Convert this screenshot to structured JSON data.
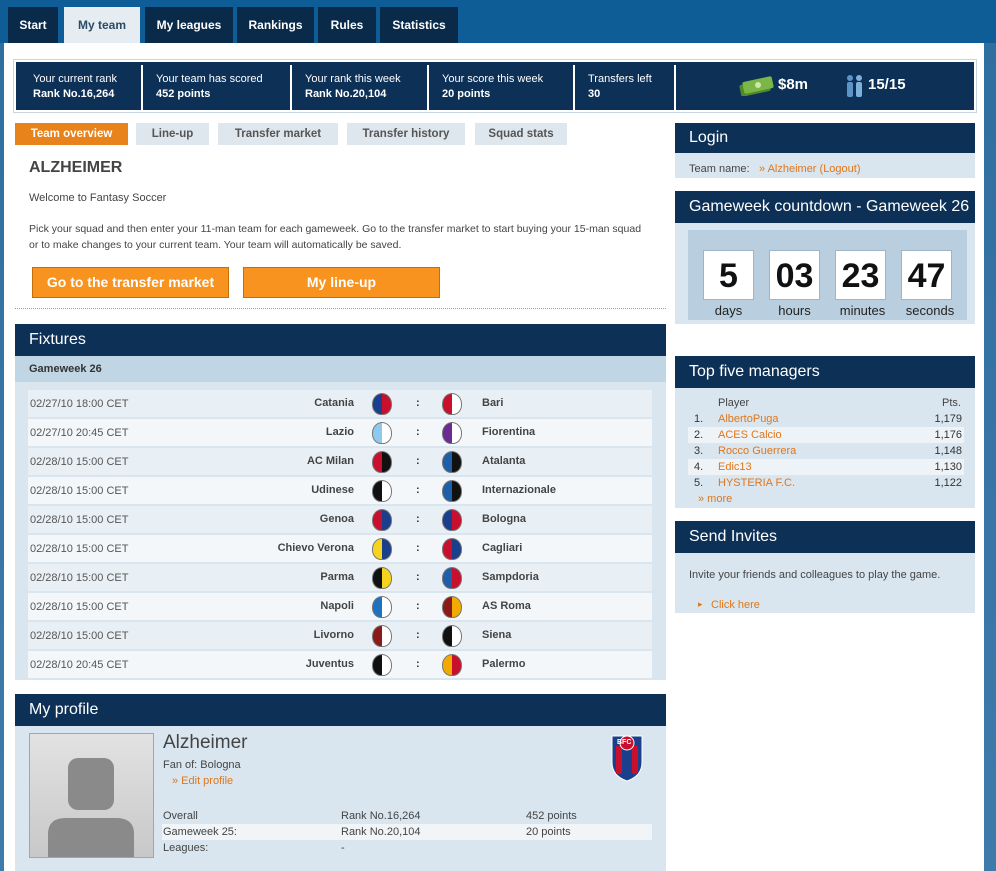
{
  "nav": {
    "tabs": [
      "Start",
      "My team",
      "My leagues",
      "Rankings",
      "Rules",
      "Statistics"
    ]
  },
  "stats": {
    "current_rank_label": "Your current rank",
    "current_rank_value": "Rank No.16,264",
    "team_scored_label": "Your team has scored",
    "team_scored_value": "452 points",
    "rank_week_label": "Your rank this week",
    "rank_week_value": "Rank No.20,104",
    "score_week_label": "Your score this week",
    "score_week_value": "20 points",
    "transfers_label": "Transfers left",
    "transfers_value": "30",
    "money": "$8m",
    "squad_count": "15/15"
  },
  "subtabs": [
    "Team overview",
    "Line-up",
    "Transfer market",
    "Transfer history",
    "Squad stats"
  ],
  "overview": {
    "team_name": "ALZHEIMER",
    "welcome": "Welcome to Fantasy Soccer",
    "intro": "Pick your squad and then enter your 11-man team for each gameweek. Go to the transfer market to start buying your 15-man squad or to make changes to your current team. Your team will automatically be saved.",
    "transfer_btn": "Go to the transfer market",
    "lineup_btn": "My line-up"
  },
  "fixtures": {
    "title": "Fixtures",
    "gameweek": "Gameweek 26",
    "rows": [
      {
        "date": "02/27/10 18:00 CET",
        "home": "Catania",
        "away": "Bari"
      },
      {
        "date": "02/27/10 20:45 CET",
        "home": "Lazio",
        "away": "Fiorentina"
      },
      {
        "date": "02/28/10 15:00 CET",
        "home": "AC Milan",
        "away": "Atalanta"
      },
      {
        "date": "02/28/10 15:00 CET",
        "home": "Udinese",
        "away": "Internazionale"
      },
      {
        "date": "02/28/10 15:00 CET",
        "home": "Genoa",
        "away": "Bologna"
      },
      {
        "date": "02/28/10 15:00 CET",
        "home": "Chievo Verona",
        "away": "Cagliari"
      },
      {
        "date": "02/28/10 15:00 CET",
        "home": "Parma",
        "away": "Sampdoria"
      },
      {
        "date": "02/28/10 15:00 CET",
        "home": "Napoli",
        "away": "AS Roma"
      },
      {
        "date": "02/28/10 15:00 CET",
        "home": "Livorno",
        "away": "Siena"
      },
      {
        "date": "02/28/10 20:45 CET",
        "home": "Juventus",
        "away": "Palermo"
      }
    ],
    "separator": ":"
  },
  "profile": {
    "title": "My profile",
    "name": "Alzheimer",
    "fan_of": "Fan of: Bologna",
    "edit": "» Edit profile",
    "club_badge": "BFC",
    "overall_label": "Overall",
    "overall_rank": "Rank No.16,264",
    "overall_points": "452 points",
    "gw_label": "Gameweek 25:",
    "gw_rank": "Rank No.20,104",
    "gw_points": "20 points",
    "leagues_label": "Leagues:",
    "leagues_value": "-"
  },
  "login": {
    "title": "Login",
    "team_label": "Team name:",
    "team_value": "» Alzheimer (Logout)"
  },
  "countdown": {
    "title": "Gameweek countdown - Gameweek 26",
    "days": "5",
    "hours": "03",
    "minutes": "23",
    "seconds": "47",
    "days_label": "days",
    "hours_label": "hours",
    "minutes_label": "minutes",
    "seconds_label": "seconds"
  },
  "top_managers": {
    "title": "Top five managers",
    "player_label": "Player",
    "pts_label": "Pts.",
    "rows": [
      {
        "n": "1.",
        "name": "AlbertoPuga",
        "pts": "1,179"
      },
      {
        "n": "2.",
        "name": "ACES Calcio",
        "pts": "1,176"
      },
      {
        "n": "3.",
        "name": "Rocco Guerrera",
        "pts": "1,148"
      },
      {
        "n": "4.",
        "name": "Edic13",
        "pts": "1,130"
      },
      {
        "n": "5.",
        "name": "HYSTERIA F.C.",
        "pts": "1,122"
      }
    ],
    "more": "» more"
  },
  "invites": {
    "title": "Send Invites",
    "text": "Invite your friends and colleagues to play the game.",
    "link": "Click here"
  },
  "colors": {
    "navy": "#0d3057",
    "orange": "#f7931e",
    "panel": "#d9e6ef"
  }
}
